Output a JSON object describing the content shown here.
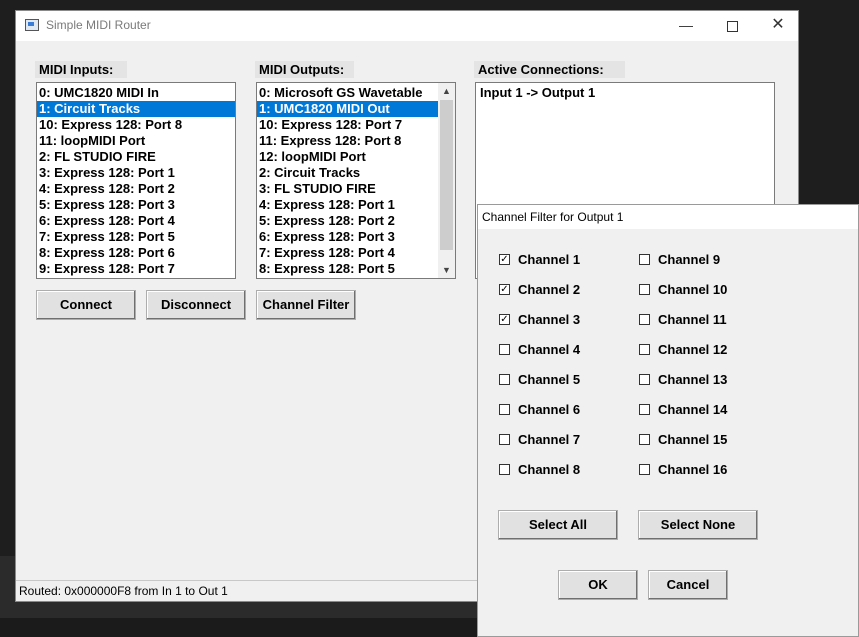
{
  "window": {
    "title": "Simple MIDI Router",
    "minimize_glyph": "—",
    "close_glyph": "✕"
  },
  "inputs": {
    "label": "MIDI Inputs:",
    "items": [
      "0: UMC1820 MIDI In",
      "1: Circuit Tracks",
      "10: Express  128: Port 8",
      "11: loopMIDI Port",
      "2: FL STUDIO FIRE",
      "3: Express  128: Port 1",
      "4: Express  128: Port 2",
      "5: Express  128: Port 3",
      "6: Express  128: Port 4",
      "7: Express  128: Port 5",
      "8: Express  128: Port 6",
      "9: Express  128: Port 7"
    ],
    "selected_index": 1
  },
  "outputs": {
    "label": "MIDI Outputs:",
    "items": [
      "0: Microsoft GS Wavetable",
      "1: UMC1820 MIDI Out",
      "10: Express  128: Port 7",
      "11: Express  128: Port 8",
      "12: loopMIDI Port",
      "2: Circuit Tracks",
      "3: FL STUDIO FIRE",
      "4: Express  128: Port 1",
      "5: Express  128: Port 2",
      "6: Express  128: Port 3",
      "7: Express  128: Port 4",
      "8: Express  128: Port 5"
    ],
    "selected_index": 1
  },
  "connections": {
    "label": "Active Connections:",
    "items": [
      "Input 1 -> Output 1"
    ]
  },
  "buttons": {
    "connect": "Connect",
    "disconnect": "Disconnect",
    "channel_filter": "Channel Filter"
  },
  "status": "Routed: 0x000000F8 from In 1 to Out 1",
  "dialog": {
    "title": "Channel Filter for Output 1",
    "channels": [
      {
        "label": "Channel 1",
        "checked": true
      },
      {
        "label": "Channel 2",
        "checked": true
      },
      {
        "label": "Channel 3",
        "checked": true
      },
      {
        "label": "Channel 4",
        "checked": false
      },
      {
        "label": "Channel 5",
        "checked": false
      },
      {
        "label": "Channel 6",
        "checked": false
      },
      {
        "label": "Channel 7",
        "checked": false
      },
      {
        "label": "Channel 8",
        "checked": false
      },
      {
        "label": "Channel 9",
        "checked": false
      },
      {
        "label": "Channel 10",
        "checked": false
      },
      {
        "label": "Channel 11",
        "checked": false
      },
      {
        "label": "Channel 12",
        "checked": false
      },
      {
        "label": "Channel 13",
        "checked": false
      },
      {
        "label": "Channel 14",
        "checked": false
      },
      {
        "label": "Channel 15",
        "checked": false
      },
      {
        "label": "Channel 16",
        "checked": false
      }
    ],
    "select_all": "Select All",
    "select_none": "Select None",
    "ok": "OK",
    "cancel": "Cancel"
  },
  "colors": {
    "selection": "#0078d7",
    "window_bg": "#f0f0f0",
    "desktop_bg": "#1e1e1e"
  },
  "icons": {
    "app": "window-icon",
    "check": "checkmark-icon",
    "scroll_up": "chevron-up-icon",
    "scroll_down": "chevron-down-icon"
  }
}
